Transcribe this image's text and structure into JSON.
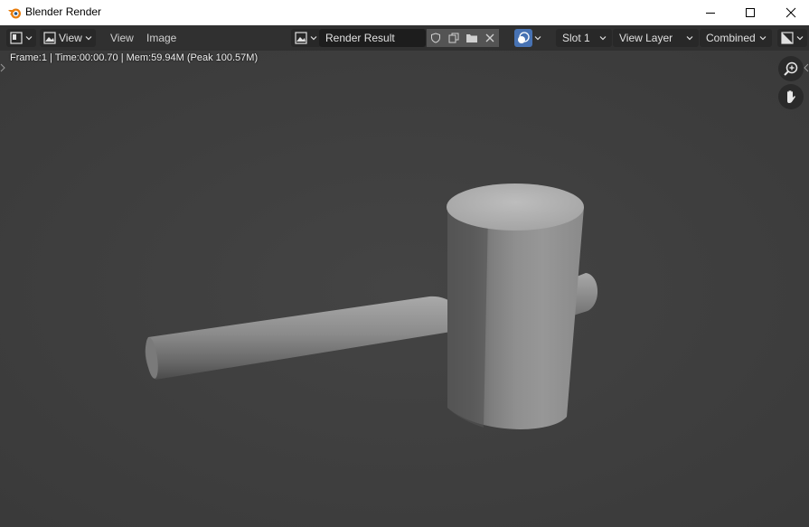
{
  "window": {
    "title": "Blender Render",
    "controls": [
      "minimize",
      "maximize",
      "close"
    ]
  },
  "header": {
    "editor_type_icon": "image-editor-icon",
    "view_mode_label": "View",
    "menus": [
      "View",
      "Image"
    ],
    "image_browse_icon": "image-browse-icon",
    "image_name": "Render Result",
    "slot": "Slot 1",
    "view_layer": "View Layer",
    "pass": "Combined",
    "display_channels_icon": "display-channels-icon"
  },
  "viewport": {
    "info_text": "Frame:1 | Time:00:00.70 | Mem:59.94M (Peak 100.57M)",
    "background_color": "#3e3e3e",
    "gizmos": [
      "zoom-icon",
      "hand-pan-icon"
    ]
  },
  "colors": {
    "accent": "#4772b3",
    "title_logo": "#e87d0d"
  }
}
